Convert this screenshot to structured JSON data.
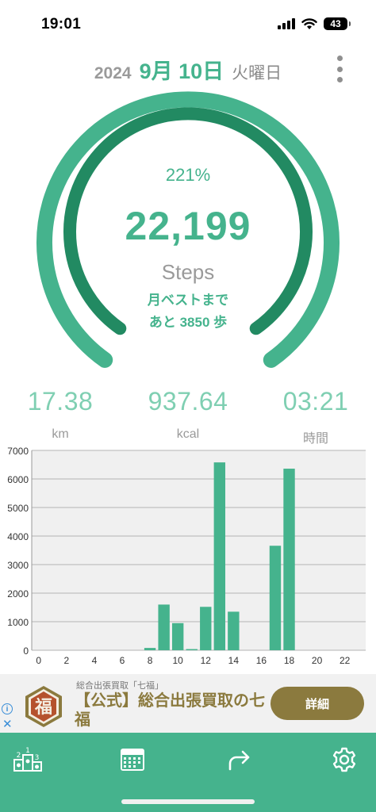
{
  "status_bar": {
    "time": "19:01",
    "battery": "43"
  },
  "header": {
    "year": "2024",
    "date": "9月 10日",
    "weekday": "火曜日"
  },
  "goal": {
    "percent": "221%",
    "steps": "22,199",
    "steps_label": "Steps",
    "best_line1": "月ベストまで",
    "best_line2": "あと 3850 歩",
    "progress_fraction": 1.0
  },
  "stats": [
    {
      "value": "17.38",
      "unit": "km"
    },
    {
      "value": "937.64",
      "unit": "kcal"
    },
    {
      "value": "03:21",
      "unit": "時間"
    }
  ],
  "chart_data": {
    "type": "bar",
    "x": [
      0,
      1,
      2,
      3,
      4,
      5,
      6,
      7,
      8,
      9,
      10,
      11,
      12,
      13,
      14,
      15,
      16,
      17,
      18,
      19,
      20,
      21,
      22,
      23
    ],
    "values": [
      0,
      0,
      0,
      0,
      0,
      0,
      0,
      0,
      80,
      1600,
      950,
      40,
      1520,
      6580,
      1350,
      0,
      0,
      3660,
      6360,
      0,
      0,
      0,
      0,
      0
    ],
    "xticks": [
      "0",
      "2",
      "4",
      "6",
      "8",
      "10",
      "12",
      "14",
      "16",
      "18",
      "20",
      "22"
    ],
    "yticks": [
      "0",
      "1000",
      "2000",
      "3000",
      "4000",
      "5000",
      "6000",
      "7000"
    ],
    "ylim": [
      0,
      7000
    ],
    "grid": true,
    "bar_color": "#45b38d"
  },
  "ad": {
    "subtitle": "総合出張買取「七福」",
    "title": "【公式】総合出張買取の七福",
    "logo_char": "福",
    "button": "詳細"
  },
  "tabs": [
    {
      "icon": "ranking-icon"
    },
    {
      "icon": "calendar-icon"
    },
    {
      "icon": "share-icon"
    },
    {
      "icon": "gear-icon"
    }
  ],
  "colors": {
    "accent": "#45b38d",
    "accent_dark": "#228a62",
    "ad_gold": "#8b7a3e"
  }
}
